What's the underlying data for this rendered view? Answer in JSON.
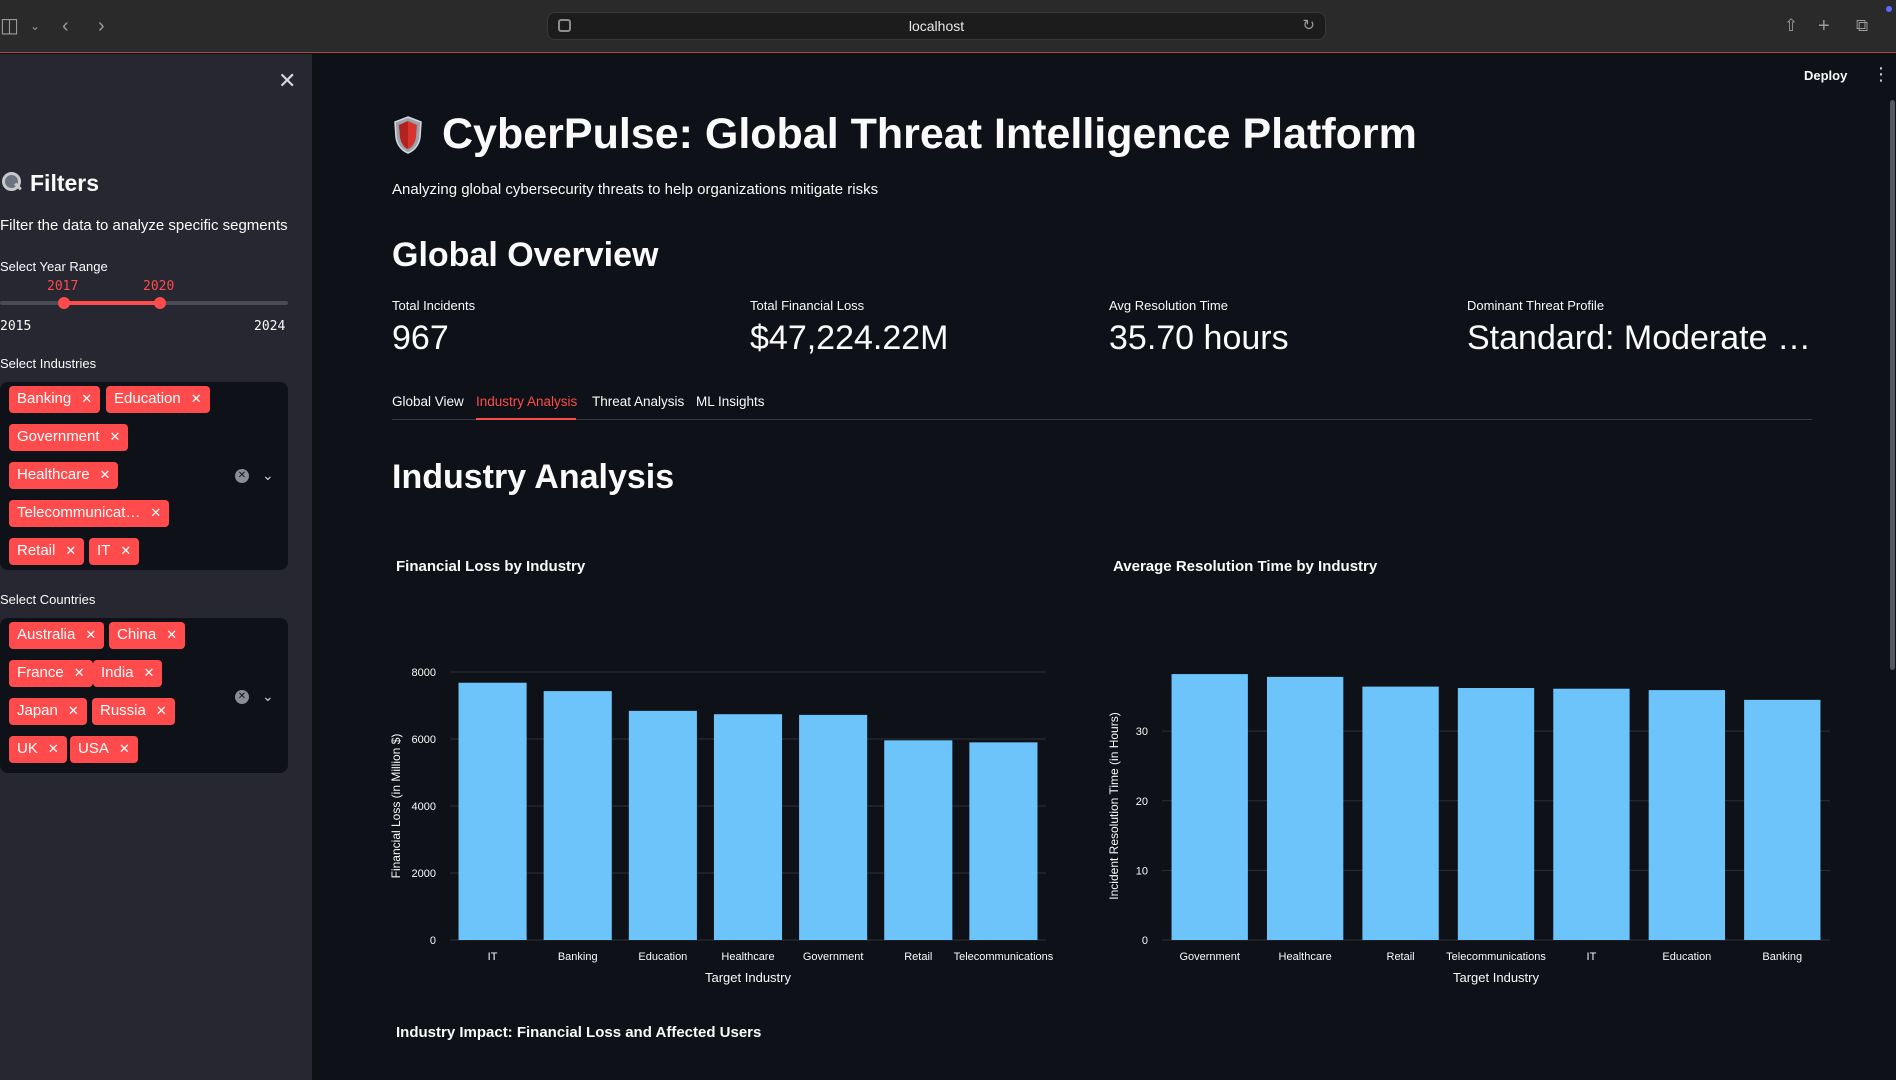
{
  "browser": {
    "url": "localhost"
  },
  "sidebar": {
    "title": "Filters",
    "description": "Filter the data to analyze specific segments",
    "year_range": {
      "label": "Select Year Range",
      "min": "2015",
      "max": "2024",
      "low": "2017",
      "high": "2020",
      "min_n": 2015,
      "max_n": 2024,
      "low_n": 2017,
      "high_n": 2020
    },
    "industries": {
      "label": "Select Industries",
      "tags": [
        "Banking",
        "Education",
        "Government",
        "Healthcare",
        "Telecommunicat…",
        "Retail",
        "IT"
      ]
    },
    "countries": {
      "label": "Select Countries",
      "tags": [
        "Australia",
        "China",
        "France",
        "India",
        "Japan",
        "Russia",
        "UK",
        "USA"
      ]
    }
  },
  "header": {
    "deploy": "Deploy"
  },
  "main": {
    "title": "CyberPulse: Global Threat Intelligence Platform",
    "subtitle": "Analyzing global cybersecurity threats to help organizations mitigate risks",
    "overview_title": "Global Overview",
    "metrics": [
      {
        "label": "Total Incidents",
        "value": "967"
      },
      {
        "label": "Total Financial Loss",
        "value": "$47,224.22M"
      },
      {
        "label": "Avg Resolution Time",
        "value": "35.70 hours"
      },
      {
        "label": "Dominant Threat Profile",
        "value": "Standard: Moderate …"
      }
    ],
    "tabs": [
      "Global View",
      "Industry Analysis",
      "Threat Analysis",
      "ML Insights"
    ],
    "active_tab": 1,
    "section_title": "Industry Analysis",
    "impact_title": "Industry Impact: Financial Loss and Affected Users"
  },
  "colors": {
    "accent": "#ff4b4b",
    "bar": "#6cc4fb",
    "background": "#0e1117",
    "sidebar": "#262730"
  },
  "chart_data": [
    {
      "type": "bar",
      "title": "Financial Loss by Industry",
      "categories": [
        "IT",
        "Banking",
        "Education",
        "Healthcare",
        "Government",
        "Retail",
        "Telecommunications"
      ],
      "values": [
        7680,
        7430,
        6840,
        6740,
        6720,
        5960,
        5900
      ],
      "xlabel": "Target Industry",
      "ylabel": "Financial Loss (in Million $)",
      "ylim": [
        0,
        8000
      ],
      "yticks": [
        0,
        2000,
        4000,
        6000,
        8000
      ],
      "grid": true
    },
    {
      "type": "bar",
      "title": "Average Resolution Time by Industry",
      "categories": [
        "Government",
        "Healthcare",
        "Retail",
        "Telecommunications",
        "IT",
        "Education",
        "Banking"
      ],
      "values": [
        38.2,
        37.8,
        36.4,
        36.2,
        36.1,
        35.9,
        34.5
      ],
      "xlabel": "Target Industry",
      "ylabel": "Incident Resolution Time (in Hours)",
      "ylim": [
        0,
        38.5
      ],
      "yticks": [
        0,
        10,
        20,
        30
      ],
      "grid": true
    }
  ]
}
